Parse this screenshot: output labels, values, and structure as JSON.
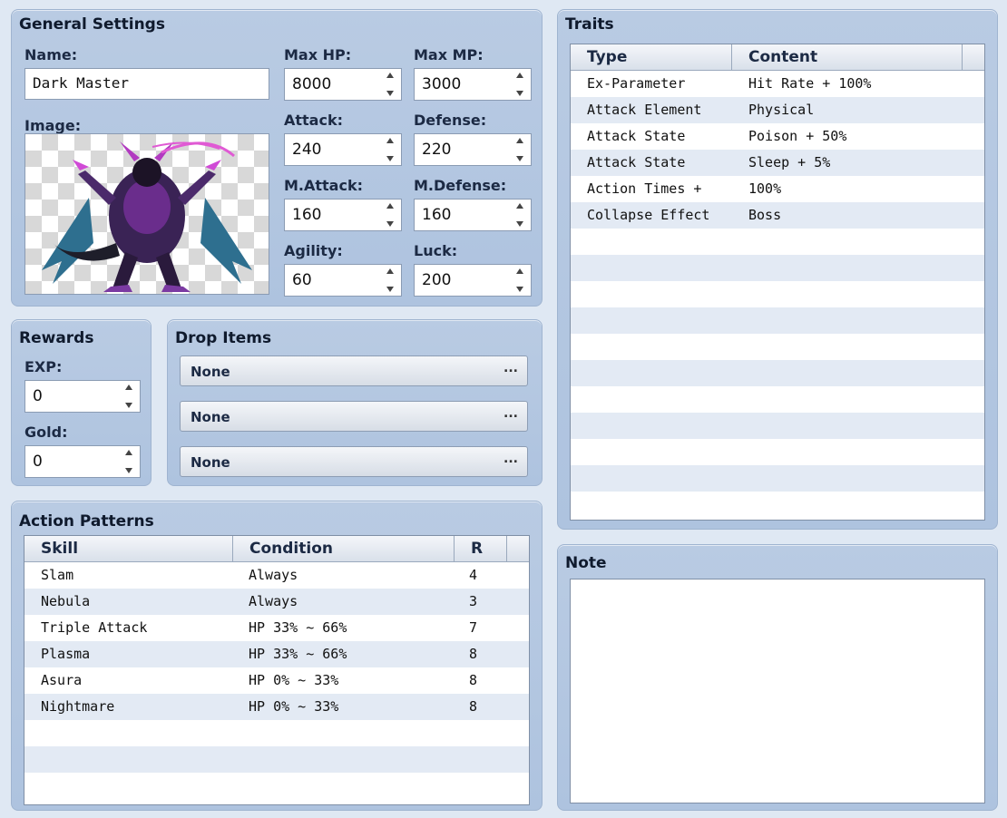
{
  "general": {
    "title": "General Settings",
    "name_label": "Name:",
    "name_value": "Dark Master",
    "image_label": "Image:",
    "max_hp_label": "Max HP:",
    "max_hp": "8000",
    "max_mp_label": "Max MP:",
    "max_mp": "3000",
    "attack_label": "Attack:",
    "attack": "240",
    "defense_label": "Defense:",
    "defense": "220",
    "mattack_label": "M.Attack:",
    "mattack": "160",
    "mdefense_label": "M.Defense:",
    "mdefense": "160",
    "agility_label": "Agility:",
    "agility": "60",
    "luck_label": "Luck:",
    "luck": "200"
  },
  "rewards": {
    "title": "Rewards",
    "exp_label": "EXP:",
    "exp": "0",
    "gold_label": "Gold:",
    "gold": "0"
  },
  "drops": {
    "title": "Drop Items",
    "items": [
      "None",
      "None",
      "None"
    ],
    "ellipsis": "..."
  },
  "actions": {
    "title": "Action Patterns",
    "columns": [
      "Skill",
      "Condition",
      "R"
    ],
    "rows": [
      [
        "Slam",
        "Always",
        "4"
      ],
      [
        "Nebula",
        "Always",
        "3"
      ],
      [
        "Triple Attack",
        "HP 33% ~ 66%",
        "7"
      ],
      [
        "Plasma",
        "HP 33% ~ 66%",
        "8"
      ],
      [
        "Asura",
        "HP 0% ~ 33%",
        "8"
      ],
      [
        "Nightmare",
        "HP 0% ~ 33%",
        "8"
      ]
    ]
  },
  "traits": {
    "title": "Traits",
    "columns": [
      "Type",
      "Content"
    ],
    "rows": [
      [
        "Ex-Parameter",
        "Hit Rate + 100%"
      ],
      [
        "Attack Element",
        "Physical"
      ],
      [
        "Attack State",
        "Poison + 50%"
      ],
      [
        "Attack State",
        "Sleep + 5%"
      ],
      [
        "Action Times +",
        "100%"
      ],
      [
        "Collapse Effect",
        "Boss"
      ]
    ]
  },
  "note": {
    "title": "Note",
    "value": ""
  },
  "colors": {
    "panel": "#b3c7e1",
    "row_alt": "#e3eaf4",
    "background": "#dfe8f3"
  },
  "icons": {
    "monster": "dark-master-monster-image"
  }
}
